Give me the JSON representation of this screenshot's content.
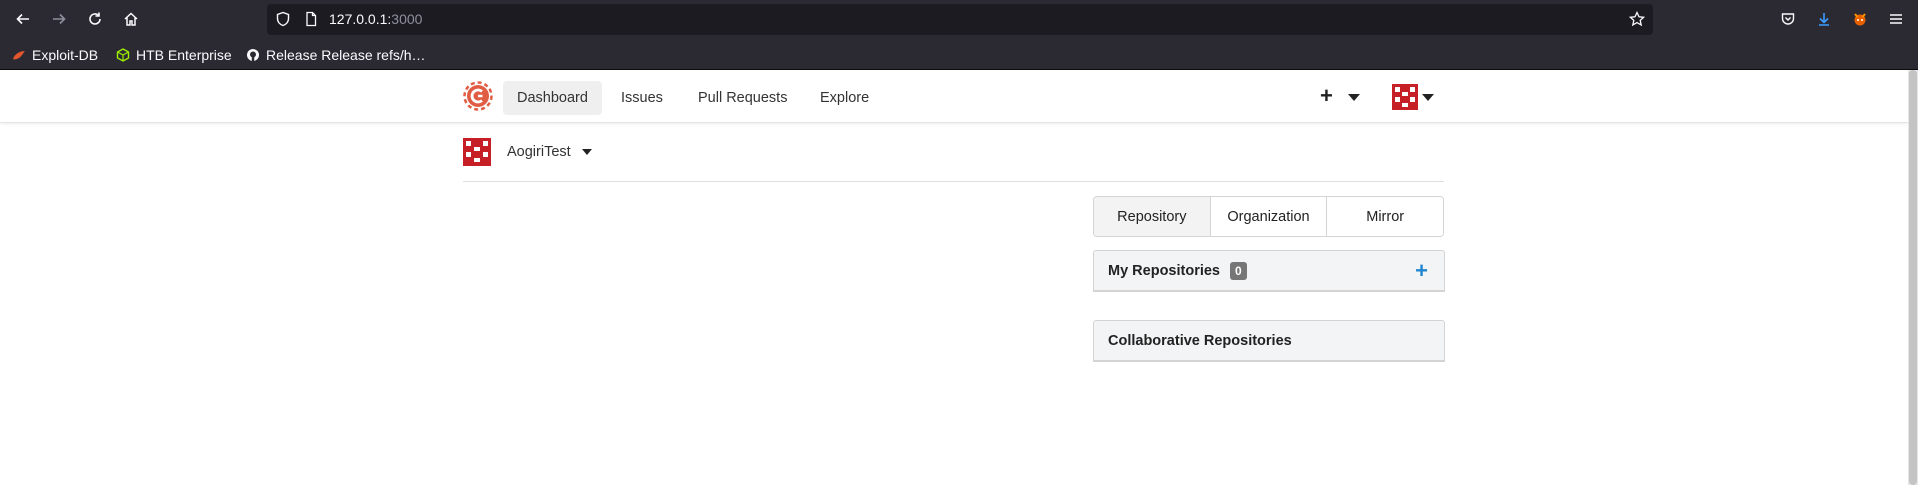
{
  "browser": {
    "url_host": "127.0.0.1:",
    "url_port": "3000",
    "bookmarks": [
      {
        "label": "Exploit-DB",
        "icon": "exploitdb-icon"
      },
      {
        "label": "HTB Enterprise",
        "icon": "htb-cube-icon"
      },
      {
        "label": "Release Release refs/h…",
        "icon": "github-icon"
      }
    ]
  },
  "navbar": {
    "items": [
      {
        "label": "Dashboard",
        "active": true
      },
      {
        "label": "Issues"
      },
      {
        "label": "Pull Requests"
      },
      {
        "label": "Explore"
      }
    ],
    "create_symbol": "+"
  },
  "context": {
    "name": "AogiriTest"
  },
  "repo_tabs": [
    "Repository",
    "Organization",
    "Mirror"
  ],
  "panels": {
    "my_repos": {
      "title": "My Repositories",
      "count": "0",
      "add_symbol": "+"
    },
    "collab_repos": {
      "title": "Collaborative Repositories"
    }
  },
  "colors": {
    "accent_blue": "#2185d0",
    "avatar_red": "#c62026",
    "gitea_orange": "#e05d44"
  }
}
